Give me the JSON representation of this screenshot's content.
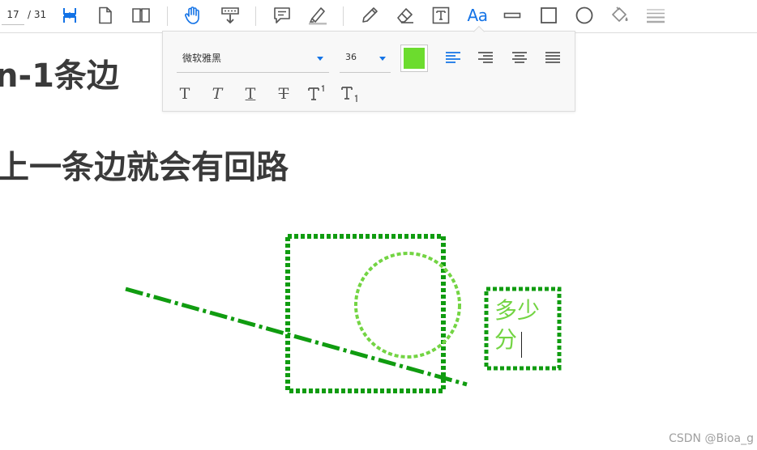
{
  "toolbar": {
    "current_page": "17",
    "total_pages": "/ 31",
    "aa_label": "Aa",
    "icons": [
      "fit-page-icon",
      "single-page-icon",
      "two-page-icon",
      "hand-tool-icon",
      "scroll-mode-icon",
      "comment-icon",
      "highlight-icon",
      "pencil-icon",
      "eraser-icon",
      "textbox-icon",
      "text-properties-icon",
      "line-icon",
      "rectangle-icon",
      "circle-icon",
      "fill-icon",
      "line-weight-icon"
    ],
    "accent_color": "#1473e6"
  },
  "text_properties": {
    "font": "微软雅黑",
    "size": "36",
    "color": "#6cdc2e",
    "align_options": [
      "align-left",
      "align-right",
      "align-center",
      "justify"
    ],
    "selected_align": "align-left",
    "format_options": [
      "plain",
      "italic",
      "underline",
      "strikethrough",
      "superscript",
      "subscript"
    ]
  },
  "document": {
    "heading1": "n-1条边",
    "heading2": "上一条边就会有回路",
    "annotation_text_line1": "多少",
    "annotation_text_line2": "分",
    "annotation_colors": {
      "dark_green": "#109c10",
      "light_green": "#73d443"
    }
  },
  "watermark": "CSDN @Bioa_g"
}
